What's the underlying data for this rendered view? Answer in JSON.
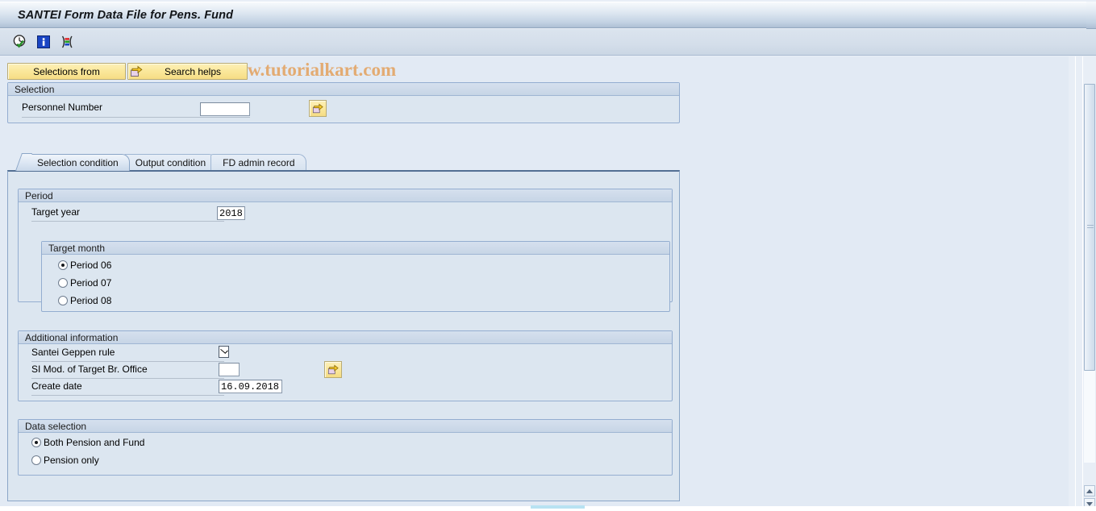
{
  "window": {
    "title": "SANTEI Form Data File for Pens. Fund"
  },
  "watermark": "© www.tutorialkart.com",
  "toolbar": {
    "icons": [
      {
        "name": "execute-clock-icon",
        "title": "Execute"
      },
      {
        "name": "info-icon",
        "title": "Information"
      },
      {
        "name": "variant-bracket-icon",
        "title": "Get Variant"
      }
    ]
  },
  "buttonbar": {
    "selections_from_label": "Selections from",
    "search_helps_label": "Search helps",
    "search_helps_icon": "multi-selection-arrow-icon"
  },
  "selection": {
    "group_title": "Selection",
    "personnel_number": {
      "label": "Personnel Number",
      "value": "",
      "placeholder": "",
      "multi_select_icon": "multi-selection-arrow-icon"
    }
  },
  "tabs": [
    {
      "id": "selection-condition",
      "label": "Selection condition",
      "active": true
    },
    {
      "id": "output-condition",
      "label": "Output condition",
      "active": false
    },
    {
      "id": "fd-admin-record",
      "label": "FD admin record",
      "active": false
    }
  ],
  "period": {
    "group_title": "Period",
    "target_year": {
      "label": "Target year",
      "value": "2018"
    },
    "target_month": {
      "group_title": "Target month",
      "options": [
        {
          "label": "Period 06",
          "selected": true
        },
        {
          "label": "Period 07",
          "selected": false
        },
        {
          "label": "Period 08",
          "selected": false
        }
      ]
    }
  },
  "additional_information": {
    "group_title": "Additional information",
    "santei_geppen_rule": {
      "label": "Santei Geppen rule",
      "checked": true
    },
    "si_mod_target_br_office": {
      "label": "SI Mod. of Target Br. Office",
      "value": "",
      "multi_select_icon": "multi-selection-arrow-icon"
    },
    "create_date": {
      "label": "Create date",
      "value": "16.09.2018"
    }
  },
  "data_selection": {
    "group_title": "Data selection",
    "options": [
      {
        "label": "Both Pension and Fund",
        "selected": true
      },
      {
        "label": "Pension only",
        "selected": false
      }
    ]
  },
  "scrollbar": {
    "up_arrow": "scroll-up-arrow-icon",
    "down_arrow": "scroll-down-arrow-icon"
  },
  "colors": {
    "title_gradient_top": "#f6f9fc",
    "title_gradient_bottom": "#aebfd4",
    "toolbar_bg": "#d4deea",
    "workspace_bg": "#e2eaf4",
    "group_bg": "#dce6f0",
    "group_header": "#c7d5e6",
    "button_yellow": "#fae79a",
    "watermark_color": "#e3ab72",
    "border_blue": "#93add0"
  }
}
